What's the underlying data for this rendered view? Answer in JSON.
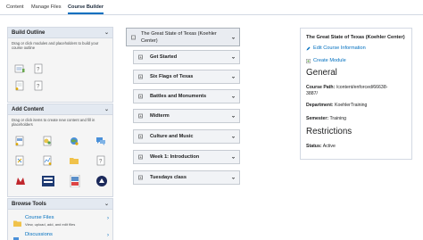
{
  "nav": {
    "tabs": [
      {
        "label": "Content"
      },
      {
        "label": "Manage Files"
      },
      {
        "label": "Course Builder"
      }
    ]
  },
  "sidebar": {
    "build_outline": {
      "title": "Build Outline",
      "description": "Drag or click modules and placeholders to build your course outline"
    },
    "add_content": {
      "title": "Add Content",
      "description": "Drag or click items to create new content and fill in placeholders"
    },
    "browse_tools": {
      "title": "Browse Tools",
      "items": [
        {
          "title": "Course Files",
          "description": "View, upload, add, and edit files"
        },
        {
          "title": "Discussions",
          "description": ""
        }
      ]
    }
  },
  "outline": {
    "root": {
      "label_line1": "The Great State of Texas (Koehler",
      "label_line2": "Center)"
    },
    "modules": [
      {
        "label": "Get Started"
      },
      {
        "label": "Six Flags of Texas"
      },
      {
        "label": "Battles and Monuments"
      },
      {
        "label": "Midterm"
      },
      {
        "label": "Culture and Music"
      },
      {
        "label": "Week 1: Introduction"
      },
      {
        "label": "Tuesdays class"
      }
    ]
  },
  "info": {
    "course_name": "The Great State of Texas (Koehler Center)",
    "edit_link": "Edit Course Information",
    "create_link": "Create Module",
    "general_heading": "General",
    "course_path_label": "Course Path:",
    "course_path_value_1": "/content/enforced/66638-",
    "course_path_value_2": "3887/",
    "department_label": "Department:",
    "department_value": "KoehlerTraining",
    "semester_label": "Semester:",
    "semester_value": "Training",
    "restrictions_heading": "Restrictions",
    "status_label": "Status:",
    "status_value": "Active"
  },
  "colors": {
    "accent": "#006fbf",
    "panel_header": "#e3e9f1",
    "panel_bg": "#f5f5f5"
  }
}
